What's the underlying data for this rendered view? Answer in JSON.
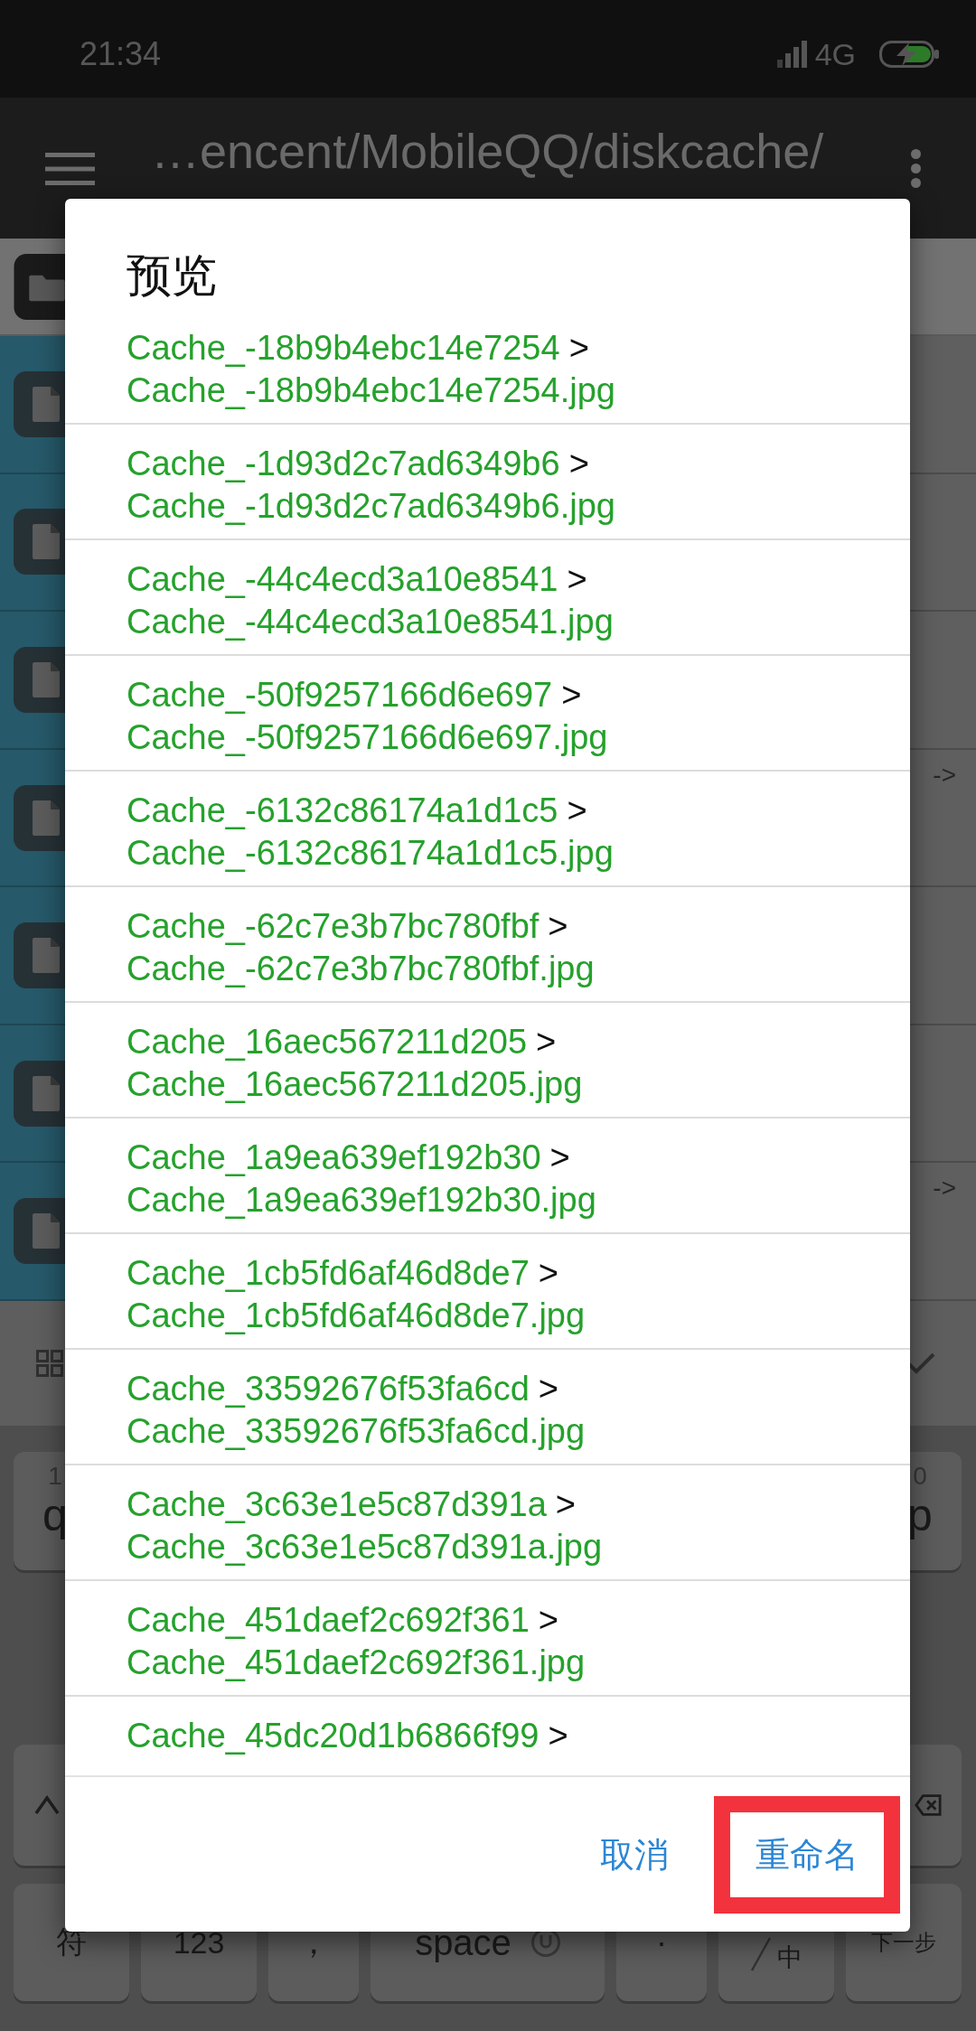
{
  "status_bar": {
    "time": "21:34",
    "network": "4G"
  },
  "toolbar": {
    "title": "…encent/MobileQQ/diskcache/"
  },
  "file_list": {
    "rows": [
      {
        "kind": "folder",
        "selected": false
      },
      {
        "kind": "file",
        "selected": true
      },
      {
        "kind": "file",
        "selected": true
      },
      {
        "kind": "file",
        "selected": true
      },
      {
        "kind": "file",
        "selected": true,
        "arrow": "->"
      },
      {
        "kind": "file",
        "selected": true
      },
      {
        "kind": "file",
        "selected": true
      },
      {
        "kind": "file",
        "selected": true,
        "arrow": "->"
      }
    ]
  },
  "keyboard": {
    "rows": [
      {
        "keys": [
          {
            "kind": "letter",
            "label": "q",
            "hint": "1"
          },
          {
            "kind": "letter",
            "label": "p",
            "hint": "0"
          }
        ]
      },
      {
        "keys": [
          {
            "kind": "shift"
          },
          {
            "kind": "delete"
          }
        ]
      },
      {
        "keys": [
          {
            "kind": "func",
            "label": "符"
          },
          {
            "kind": "func",
            "label": "123"
          },
          {
            "kind": "punct",
            "label": "，"
          },
          {
            "kind": "space",
            "label": "space"
          },
          {
            "kind": "punct",
            "label": "·"
          },
          {
            "kind": "lang",
            "label": "中"
          },
          {
            "kind": "func",
            "label": "下一步"
          }
        ]
      }
    ]
  },
  "dialog": {
    "title": "预览",
    "items": [
      {
        "from": "Cache_-18b9b4ebc14e7254",
        "arrow": ">",
        "to": "Cache_-18b9b4ebc14e7254.jpg"
      },
      {
        "from": "Cache_-1d93d2c7ad6349b6",
        "arrow": ">",
        "to": "Cache_-1d93d2c7ad6349b6.jpg"
      },
      {
        "from": "Cache_-44c4ecd3a10e8541",
        "arrow": ">",
        "to": "Cache_-44c4ecd3a10e8541.jpg"
      },
      {
        "from": "Cache_-50f9257166d6e697",
        "arrow": ">",
        "to": "Cache_-50f9257166d6e697.jpg"
      },
      {
        "from": "Cache_-6132c86174a1d1c5",
        "arrow": ">",
        "to": "Cache_-6132c86174a1d1c5.jpg"
      },
      {
        "from": "Cache_-62c7e3b7bc780fbf",
        "arrow": ">",
        "to": "Cache_-62c7e3b7bc780fbf.jpg"
      },
      {
        "from": "Cache_16aec567211d205",
        "arrow": ">",
        "to": "Cache_16aec567211d205.jpg"
      },
      {
        "from": "Cache_1a9ea639ef192b30",
        "arrow": ">",
        "to": "Cache_1a9ea639ef192b30.jpg"
      },
      {
        "from": "Cache_1cb5fd6af46d8de7",
        "arrow": ">",
        "to": "Cache_1cb5fd6af46d8de7.jpg"
      },
      {
        "from": "Cache_33592676f53fa6cd",
        "arrow": ">",
        "to": "Cache_33592676f53fa6cd.jpg"
      },
      {
        "from": "Cache_3c63e1e5c87d391a",
        "arrow": ">",
        "to": "Cache_3c63e1e5c87d391a.jpg"
      },
      {
        "from": "Cache_451daef2c692f361",
        "arrow": ">",
        "to": "Cache_451daef2c692f361.jpg"
      },
      {
        "from": "Cache_45dc20d1b6866f99",
        "arrow": ">"
      }
    ],
    "buttons": [
      {
        "label": "取消",
        "highlighted": false
      },
      {
        "label": "重命名",
        "highlighted": true
      }
    ]
  }
}
